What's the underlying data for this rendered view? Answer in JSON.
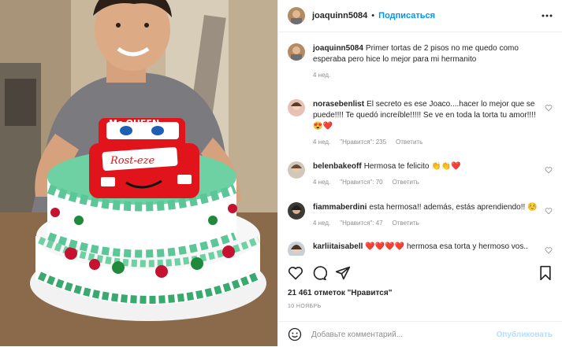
{
  "colors": {
    "accent": "#0095f6",
    "muted": "#8e8e8e",
    "text": "#262626",
    "heart_red": "#ed4956"
  },
  "header": {
    "username": "joaquinn5084",
    "separator": "•",
    "follow_label": "Подписаться",
    "more_icon": "ellipsis-icon"
  },
  "caption": {
    "username": "joaquinn5084",
    "text": "Primer tortas de 2 pisos no me quedo como esperaba pero hice lo mejor para mi hermanito",
    "time": "4 нед."
  },
  "comments": [
    {
      "username": "norasebenlist",
      "text": "El secreto es ese Joaco....hacer lo mejor que se puede!!!! Te quedó increíble!!!!! Se ve en toda la torta tu amor!!!! 😍❤️",
      "time": "4 нед.",
      "likes": "\"Нравится\": 235",
      "reply": "Ответить"
    },
    {
      "username": "belenbakeoff",
      "text": "Hermosa te felicito 👏👏❤️",
      "time": "4 нед.",
      "likes": "\"Нравится\": 70",
      "reply": "Ответить"
    },
    {
      "username": "fiammaberdini",
      "text": "esta hermosa!! además, estás aprendiendo!! ☺️",
      "time": "4 нед.",
      "likes": "\"Нравится\": 47",
      "reply": "Ответить"
    },
    {
      "username": "karliitaisabell",
      "text": "❤️❤️❤️❤️ hermosa esa torta y hermoso vos..",
      "time": "",
      "likes": "",
      "reply": ""
    }
  ],
  "likes_text": "21 461 отметок \"Нравится\"",
  "date": "10 НОЯБРЬ",
  "add_comment": {
    "placeholder": "Добавьте комментарий...",
    "publish_label": "Опубликовать"
  },
  "photo": {
    "cake_text_top": "Mc.QUEEN",
    "cake_text_side": "Rost-eze"
  }
}
